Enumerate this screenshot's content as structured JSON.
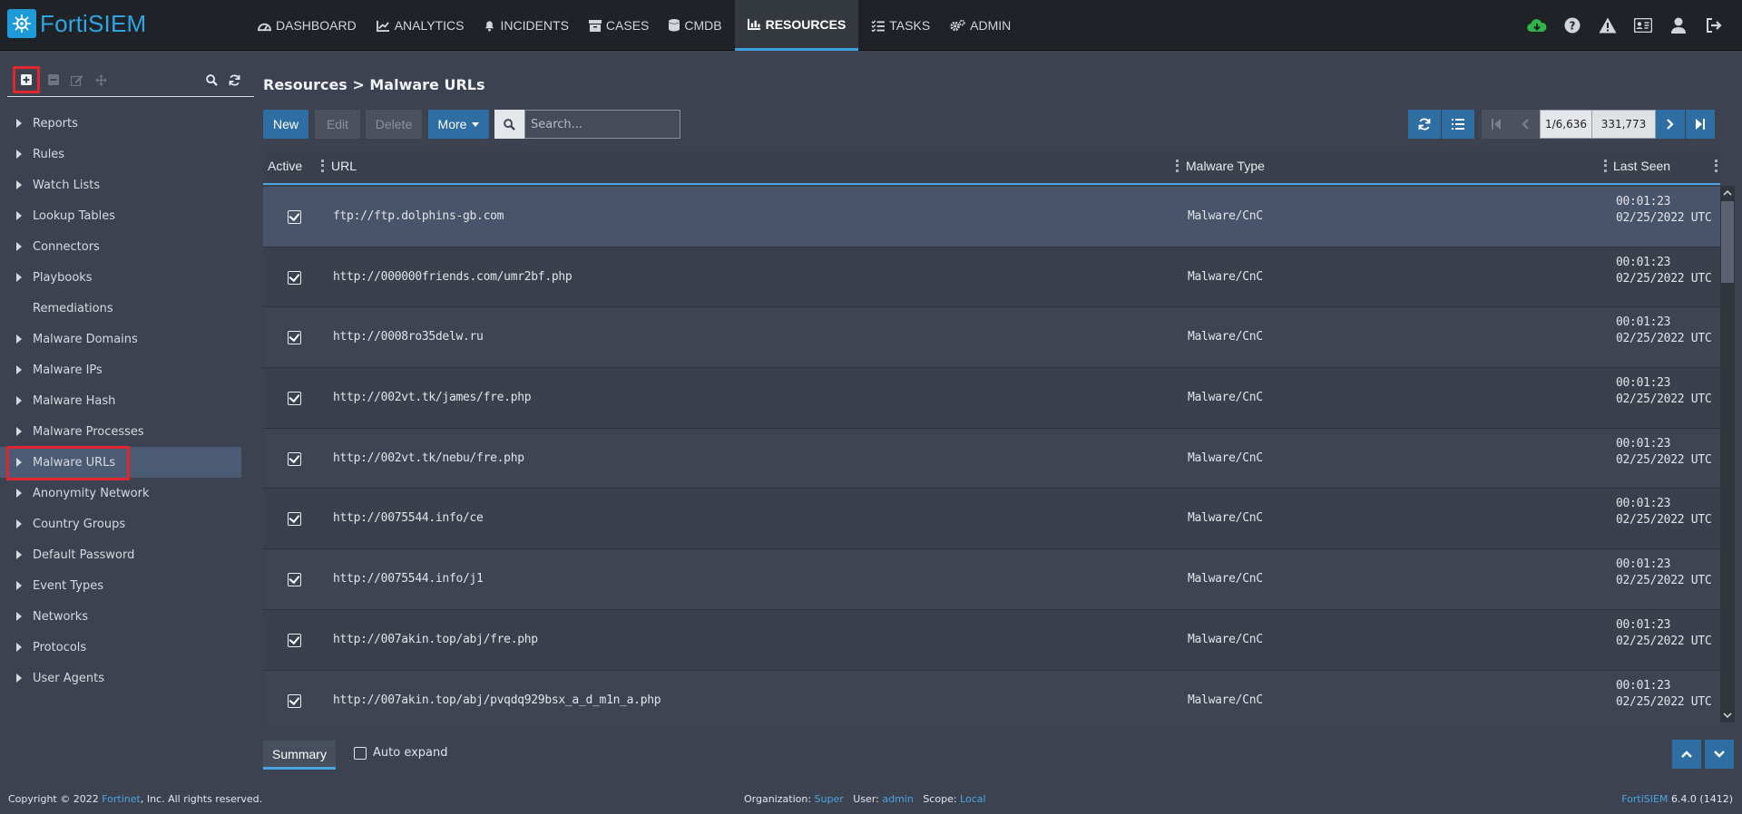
{
  "app": {
    "brand": "FortiSIEM"
  },
  "nav": [
    {
      "label": "DASHBOARD",
      "icon": "dashboard-icon"
    },
    {
      "label": "ANALYTICS",
      "icon": "chart-icon"
    },
    {
      "label": "INCIDENTS",
      "icon": "bell-icon"
    },
    {
      "label": "CASES",
      "icon": "archive-icon"
    },
    {
      "label": "CMDB",
      "icon": "database-icon"
    },
    {
      "label": "RESOURCES",
      "icon": "bar-chart-icon",
      "active": true
    },
    {
      "label": "TASKS",
      "icon": "tasks-icon"
    },
    {
      "label": "ADMIN",
      "icon": "gears-icon"
    }
  ],
  "top_icons": [
    "cloud-download-icon",
    "help-icon",
    "warning-icon",
    "id-card-icon",
    "user-icon",
    "logout-icon"
  ],
  "sidebar": {
    "items": [
      {
        "label": "Reports",
        "expandable": true
      },
      {
        "label": "Rules",
        "expandable": true
      },
      {
        "label": "Watch Lists",
        "expandable": true
      },
      {
        "label": "Lookup Tables",
        "expandable": true
      },
      {
        "label": "Connectors",
        "expandable": true
      },
      {
        "label": "Playbooks",
        "expandable": true
      },
      {
        "label": "Remediations",
        "expandable": false
      },
      {
        "label": "Malware Domains",
        "expandable": true
      },
      {
        "label": "Malware IPs",
        "expandable": true
      },
      {
        "label": "Malware Hash",
        "expandable": true
      },
      {
        "label": "Malware Processes",
        "expandable": true
      },
      {
        "label": "Malware URLs",
        "expandable": true,
        "selected": true
      },
      {
        "label": "Anonymity Network",
        "expandable": true
      },
      {
        "label": "Country Groups",
        "expandable": true
      },
      {
        "label": "Default Password",
        "expandable": true
      },
      {
        "label": "Event Types",
        "expandable": true
      },
      {
        "label": "Networks",
        "expandable": true
      },
      {
        "label": "Protocols",
        "expandable": true
      },
      {
        "label": "User Agents",
        "expandable": true
      }
    ]
  },
  "main": {
    "breadcrumb": "Resources > Malware URLs",
    "toolbar": {
      "new_label": "New",
      "edit_label": "Edit",
      "delete_label": "Delete",
      "more_label": "More",
      "search_placeholder": "Search..."
    },
    "pager": {
      "page": "1/6,636",
      "total": "331,773"
    },
    "columns": [
      "Active",
      "URL",
      "Malware Type",
      "Last Seen"
    ],
    "rows": [
      {
        "active": true,
        "url": "ftp://ftp.dolphins-gb.com",
        "type": "Malware/CnC",
        "seen": "00:01:23 02/25/2022 UTC"
      },
      {
        "active": true,
        "url": "http://000000friends.com/umr2bf.php",
        "type": "Malware/CnC",
        "seen": "00:01:23 02/25/2022 UTC"
      },
      {
        "active": true,
        "url": "http://0008ro35delw.ru",
        "type": "Malware/CnC",
        "seen": "00:01:23 02/25/2022 UTC"
      },
      {
        "active": true,
        "url": "http://002vt.tk/james/fre.php",
        "type": "Malware/CnC",
        "seen": "00:01:23 02/25/2022 UTC"
      },
      {
        "active": true,
        "url": "http://002vt.tk/nebu/fre.php",
        "type": "Malware/CnC",
        "seen": "00:01:23 02/25/2022 UTC"
      },
      {
        "active": true,
        "url": "http://0075544.info/ce",
        "type": "Malware/CnC",
        "seen": "00:01:23 02/25/2022 UTC"
      },
      {
        "active": true,
        "url": "http://0075544.info/j1",
        "type": "Malware/CnC",
        "seen": "00:01:23 02/25/2022 UTC"
      },
      {
        "active": true,
        "url": "http://007akin.top/abj/fre.php",
        "type": "Malware/CnC",
        "seen": "00:01:23 02/25/2022 UTC"
      },
      {
        "active": true,
        "url": "http://007akin.top/abj/pvqdq929bsx_a_d_m1n_a.php",
        "type": "Malware/CnC",
        "seen": "00:01:23 02/25/2022 UTC"
      }
    ],
    "summary_tab": "Summary",
    "auto_expand_label": "Auto expand"
  },
  "footer": {
    "copyright_pre": "Copyright © 2022 ",
    "company": "Fortinet",
    "copyright_post": ", Inc. All rights reserved.",
    "org_label": "Organization:",
    "org_value": "Super",
    "user_label": "User:",
    "user_value": "admin",
    "scope_label": "Scope:",
    "scope_value": "Local",
    "product": "FortiSIEM",
    "version": "6.4.0 (1412)"
  },
  "colors": {
    "accent": "#2e6ea2",
    "brand": "#2ea6e6",
    "highlight": "#e0262c",
    "link": "#4aa4e2"
  }
}
